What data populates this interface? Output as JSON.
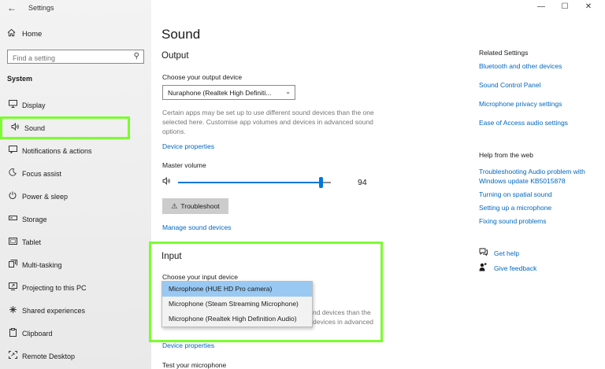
{
  "window": {
    "title": "Settings",
    "controls": [
      "—",
      "☐",
      "✕"
    ]
  },
  "sidebar": {
    "home_label": "Home",
    "search_placeholder": "Find a setting",
    "section": "System",
    "items": [
      {
        "label": "Display",
        "icon": "display-icon"
      },
      {
        "label": "Sound",
        "icon": "sound-icon",
        "active": true
      },
      {
        "label": "Notifications & actions",
        "icon": "notifications-icon"
      },
      {
        "label": "Focus assist",
        "icon": "focus-assist-icon"
      },
      {
        "label": "Power & sleep",
        "icon": "power-icon"
      },
      {
        "label": "Storage",
        "icon": "storage-icon"
      },
      {
        "label": "Tablet",
        "icon": "tablet-icon"
      },
      {
        "label": "Multi-tasking",
        "icon": "multitasking-icon"
      },
      {
        "label": "Projecting to this PC",
        "icon": "projecting-icon"
      },
      {
        "label": "Shared experiences",
        "icon": "shared-icon"
      },
      {
        "label": "Clipboard",
        "icon": "clipboard-icon"
      },
      {
        "label": "Remote Desktop",
        "icon": "remote-desktop-icon"
      }
    ]
  },
  "main": {
    "title": "Sound",
    "output": {
      "heading": "Output",
      "device_label": "Choose your output device",
      "device_value": "Nuraphone (Realtek High Definiti...",
      "info": "Certain apps may be set up to use different sound devices than the one selected here. Customise app volumes and devices in advanced sound options.",
      "device_properties": "Device properties",
      "master_volume_label": "Master volume",
      "master_volume_value": "94",
      "master_volume": 94,
      "troubleshoot": "Troubleshoot",
      "manage_devices": "Manage sound devices"
    },
    "input": {
      "heading": "Input",
      "device_label": "Choose your input device",
      "options": [
        "Microphone (HUE HD Pro camera)",
        "Microphone (Steam Streaming Microphone)",
        "Microphone (Realtek High Definition Audio)"
      ],
      "partial_info_1": "nd devices than the",
      "partial_info_2": "devices in advanced",
      "device_properties": "Device properties",
      "test_label": "Test your microphone"
    }
  },
  "right": {
    "related_heading": "Related Settings",
    "related_links": [
      "Bluetooth and other devices",
      "Sound Control Panel",
      "Microphone privacy settings",
      "Ease of Access audio settings"
    ],
    "help_heading": "Help from the web",
    "help_links": [
      "Troubleshooting Audio problem with Windows update KB5015878",
      "Turning on spatial sound",
      "Setting up a microphone",
      "Fixing sound problems"
    ],
    "get_help": "Get help",
    "give_feedback": "Give feedback"
  },
  "colors": {
    "highlight": "#7cfc30",
    "accent": "#0078d7",
    "link": "#0067c0",
    "selected_option": "#99c9f2"
  }
}
